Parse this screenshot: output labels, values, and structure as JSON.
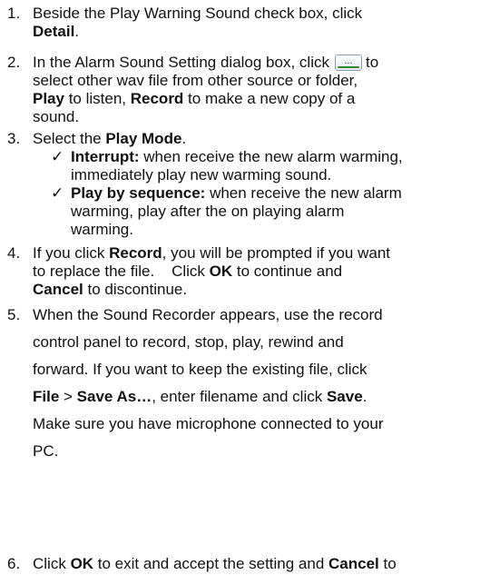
{
  "steps": [
    {
      "num": "1.",
      "lines": [
        {
          "t1": "Beside the Play Warning Sound check box, click"
        },
        {
          "b1": "Detail",
          "t2": "."
        }
      ]
    },
    {
      "num": "2.",
      "lines": [
        {
          "t1": "In the Alarm Sound Setting dialog box, click",
          "t2": "to"
        },
        {
          "t1": "select other wav file from other source or folder,"
        },
        {
          "b1": "Play",
          "t1": " to listen, ",
          "b2": "Record",
          "t2": " to make a new copy of a"
        },
        {
          "t1": "sound."
        }
      ],
      "button_icon": "browse-ellipsis-button-icon",
      "button_icon_glyph": "..."
    },
    {
      "num": "3.",
      "lines": [
        {
          "t1": "Select the ",
          "b1": "Play Mode",
          "t2": "."
        }
      ],
      "subitems": [
        {
          "check": "✓",
          "lines": [
            {
              "b1": "Interrupt:",
              "t1": " when receive the new alarm warming,"
            },
            {
              "t1": "immediately play new warming sound."
            }
          ]
        },
        {
          "check": "✓",
          "lines": [
            {
              "b1": "Play by sequence:",
              "t1": " when receive the new alarm"
            },
            {
              "t1": "warming, play after the on playing alarm"
            },
            {
              "t1": "warming."
            }
          ]
        }
      ]
    },
    {
      "num": "4.",
      "lines": [
        {
          "t1": "If you click ",
          "b1": "Record",
          "t2": ", you will be prompted if you want"
        },
        {
          "t1": "to replace the file.    Click ",
          "b1": "OK",
          "t2": " to continue and"
        },
        {
          "b1": "Cancel",
          "t1": " to discontinue."
        }
      ]
    },
    {
      "num": "5.",
      "lines": [
        {
          "t1": "When the Sound Recorder appears, use the record"
        },
        {
          "t1": "control panel to record, stop, play, rewind and"
        },
        {
          "t1": "forward. If you want to keep the existing file, click"
        },
        {
          "b1": "File",
          "t1": " > ",
          "b2": "Save As…",
          "t2": ", enter filename and click ",
          "b3": "Save",
          "t3": "."
        },
        {
          "t1": "Make sure you have microphone connected to your"
        },
        {
          "t1": "PC."
        }
      ]
    },
    {
      "num": "6.",
      "lines": [
        {
          "t1": "Click ",
          "b1": "OK",
          "t2": " to exit and accept the setting and ",
          "b2": "Cancel",
          "t3": " to"
        }
      ]
    }
  ]
}
